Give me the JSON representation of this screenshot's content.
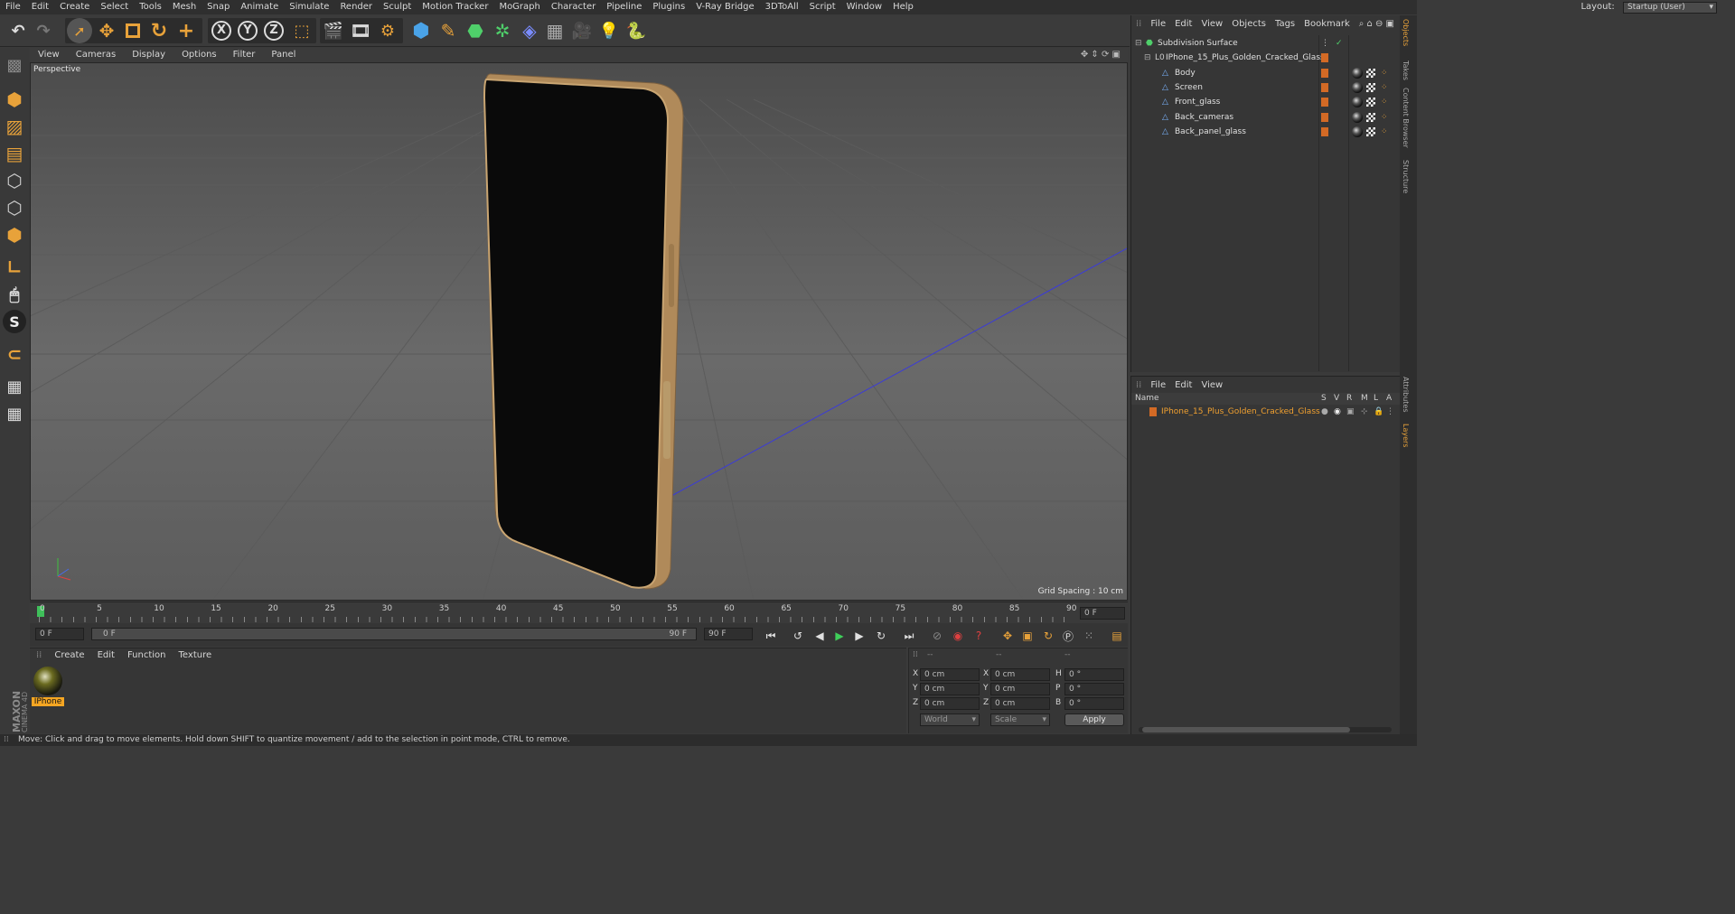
{
  "menu": [
    "File",
    "Edit",
    "Create",
    "Select",
    "Tools",
    "Mesh",
    "Snap",
    "Animate",
    "Simulate",
    "Render",
    "Sculpt",
    "Motion Tracker",
    "MoGraph",
    "Character",
    "Pipeline",
    "Plugins",
    "V-Ray Bridge",
    "3DToAll",
    "Script",
    "Window",
    "Help"
  ],
  "layout": {
    "label": "Layout:",
    "value": "Startup (User)"
  },
  "toolbar": {
    "x": "X",
    "y": "Y",
    "z": "Z"
  },
  "viewport": {
    "menu": [
      "View",
      "Cameras",
      "Display",
      "Options",
      "Filter",
      "Panel"
    ],
    "label": "Perspective",
    "grid_spacing": "Grid Spacing : 10 cm"
  },
  "timeline": {
    "ticks": [
      "0",
      "5",
      "10",
      "15",
      "20",
      "25",
      "30",
      "35",
      "40",
      "45",
      "50",
      "55",
      "60",
      "65",
      "70",
      "75",
      "80",
      "85",
      "90"
    ],
    "current_frame": "0 F"
  },
  "transport": {
    "start": "0 F",
    "range_start": "0 F",
    "range_end": "90 F",
    "end": "90 F"
  },
  "material_manager": {
    "menu": [
      "Create",
      "Edit",
      "Function",
      "Texture"
    ],
    "material_name": "IPhone"
  },
  "coordinates": {
    "headers": [
      "--",
      "--",
      "--"
    ],
    "pos": [
      {
        "axis": "X",
        "value": "0 cm"
      },
      {
        "axis": "Y",
        "value": "0 cm"
      },
      {
        "axis": "Z",
        "value": "0 cm"
      }
    ],
    "size": [
      {
        "axis": "X",
        "value": "0 cm"
      },
      {
        "axis": "Y",
        "value": "0 cm"
      },
      {
        "axis": "Z",
        "value": "0 cm"
      }
    ],
    "rot": [
      {
        "axis": "H",
        "value": "0 °"
      },
      {
        "axis": "P",
        "value": "0 °"
      },
      {
        "axis": "B",
        "value": "0 °"
      }
    ],
    "mode1": "World",
    "mode2": "Scale",
    "apply": "Apply"
  },
  "object_manager": {
    "menu": [
      "File",
      "Edit",
      "View",
      "Objects",
      "Tags",
      "Bookmark"
    ],
    "objects": [
      {
        "name": "Subdivision Surface"
      },
      {
        "name": "IPhone_15_Plus_Golden_Cracked_Glass"
      },
      {
        "name": "Body"
      },
      {
        "name": "Screen"
      },
      {
        "name": "Front_glass"
      },
      {
        "name": "Back_cameras"
      },
      {
        "name": "Back_panel_glass"
      }
    ]
  },
  "layer_manager": {
    "menu": [
      "File",
      "Edit",
      "View"
    ],
    "columns": {
      "name": "Name",
      "flags": [
        "S",
        "V",
        "R",
        "M",
        "L",
        "A"
      ]
    },
    "layer": "IPhone_15_Plus_Golden_Cracked_Glass"
  },
  "side_tabs": [
    "Objects",
    "Takes",
    "Content Browser",
    "Structure",
    "Attributes",
    "Layers"
  ],
  "status": "Move: Click and drag to move elements. Hold down SHIFT to quantize movement / add to the selection in point mode, CTRL to remove.",
  "brand": "MAXON CINEMA 4D",
  "colors": {
    "accent": "#e8a23a",
    "layer_text": "#f0a030",
    "swatch": "#d36a25",
    "selection": "#f5a623"
  }
}
